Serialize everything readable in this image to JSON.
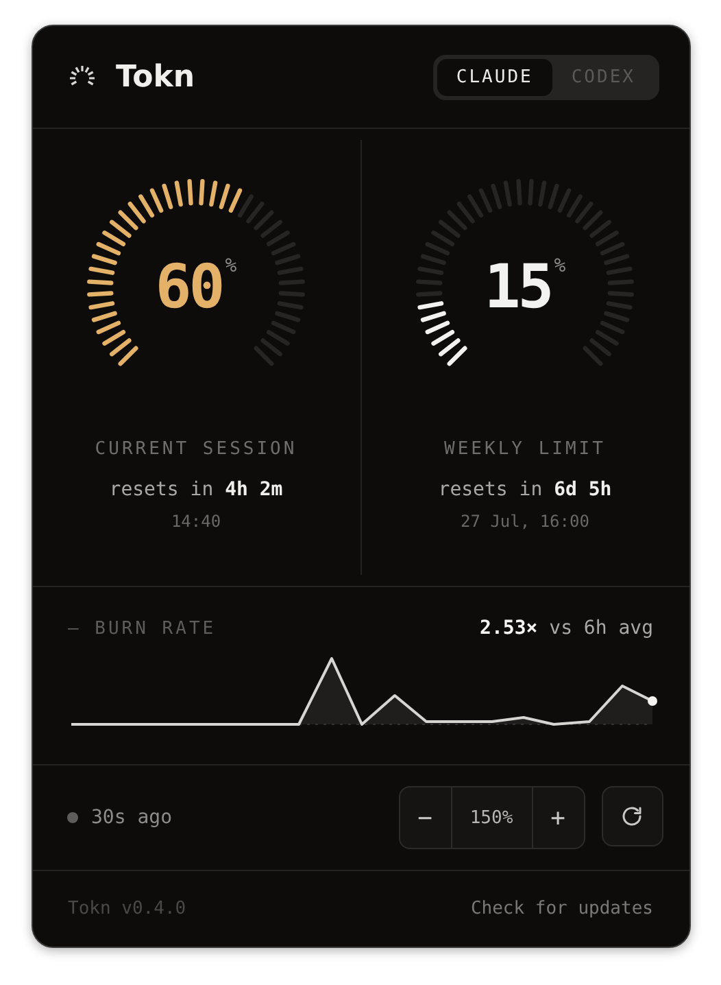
{
  "app": {
    "title": "Tokn"
  },
  "providers": [
    {
      "label": "CLAUDE",
      "selected": true
    },
    {
      "label": "CODEX",
      "selected": false
    }
  ],
  "gauges": [
    {
      "value": "60",
      "unit": "%",
      "level": 0.6,
      "color": "#e3b168",
      "label": "CURRENT SESSION",
      "resets": "resets in **4h 2m**",
      "reset_time": "14:40"
    },
    {
      "value": "15",
      "unit": "%",
      "level": 0.15,
      "color": "#f2f2f0",
      "label": "WEEKLY LIMIT",
      "resets": "resets in **6d 5h**",
      "reset_time": "27 Jul, 16:00"
    }
  ],
  "burn_rate": {
    "marker": "—",
    "label": "BURN RATE",
    "value": "2.53×",
    "comparison": "vs 6h avg"
  },
  "status": {
    "updated": "30s ago"
  },
  "zoom": {
    "decrease": "−",
    "value": "150%",
    "increase": "+"
  },
  "footer": {
    "version": "Tokn v0.4.0",
    "link": "Check for updates"
  }
}
